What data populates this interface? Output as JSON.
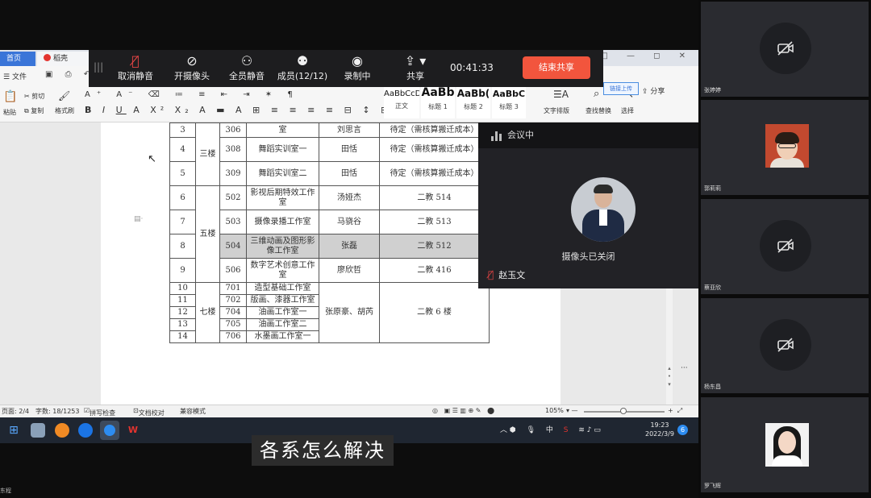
{
  "wps": {
    "tabs": {
      "home": "首页",
      "doc": "稻壳"
    },
    "window_controls": "□ — ◻ ✕",
    "share_note": "链接上传",
    "share": "分享",
    "file_menu": "文件",
    "ribbon": {
      "cut": "剪切",
      "copy": "复制",
      "paste": "粘贴",
      "format_painter": "格式刷",
      "styles": [
        {
          "sample": "AaBbCcDd",
          "label": "正文"
        },
        {
          "sample": "AaBb",
          "label": "标题 1"
        },
        {
          "sample": "AaBb(",
          "label": "标题 2"
        },
        {
          "sample": "AaBbC",
          "label": "标题 3"
        }
      ],
      "text_layout": "文字排版",
      "find_replace": "查找替换",
      "select": "选择"
    }
  },
  "table": {
    "rows": [
      {
        "no": "3",
        "room": "306",
        "name": "室",
        "person": "刘思言",
        "plan": "待定（需核算搬迁成本）"
      },
      {
        "no": "4",
        "room": "308",
        "name": "舞蹈实训室一",
        "person": "田恬",
        "plan": "待定（需核算搬迁成本）"
      },
      {
        "no": "5",
        "room": "309",
        "name": "舞蹈实训室二",
        "person": "田恬",
        "plan": "待定（需核算搬迁成本）"
      },
      {
        "no": "6",
        "room": "502",
        "name": "影视后期特效工作室",
        "person": "汤娅杰",
        "plan": "二教 514"
      },
      {
        "no": "7",
        "room": "503",
        "name": "摄像录播工作室",
        "person": "马骁谷",
        "plan": "二教 513"
      },
      {
        "no": "8",
        "room": "504",
        "name": "三维动画及图形影像工作室",
        "person": "张磊",
        "plan": "二教 512"
      },
      {
        "no": "9",
        "room": "506",
        "name": "数字艺术创意工作室",
        "person": "廖欣哲",
        "plan": "二教 416"
      },
      {
        "no": "10",
        "room": "701",
        "name": "造型基础工作室"
      },
      {
        "no": "11",
        "room": "702",
        "name": "版画、漆器工作室"
      },
      {
        "no": "12",
        "room": "704",
        "name": "油画工作室一"
      },
      {
        "no": "13",
        "room": "705",
        "name": "油画工作室二"
      },
      {
        "no": "14",
        "room": "706",
        "name": "水墨画工作室一"
      }
    ],
    "floor_3": "三楼",
    "floor_5": "五楼",
    "floor_7": "七楼",
    "floor7_person": "张原豪、胡芮",
    "floor7_plan": "二教 6 楼"
  },
  "statusbar": {
    "page": "页面: 2/4",
    "words": "字数: 18/1253",
    "spellcheck": "拼写检查",
    "proofread": "文档校对",
    "compat": "兼容模式",
    "zoom": "105%"
  },
  "taskbar": {
    "tray_input": "中",
    "time": "19:23",
    "date": "2022/3/9",
    "notifications": "6"
  },
  "meeting": {
    "controls": {
      "unmute": "取消静音",
      "camera_on": "开摄像头",
      "mute_all": "全员静音",
      "members": "成员(12/12)",
      "recording": "录制中",
      "share": "共享"
    },
    "elapsed": "00:41:33",
    "end_share": "结束共享",
    "speaker_window": {
      "status": "会议中",
      "camera_off": "摄像头已关闭",
      "name": "赵玉文"
    },
    "participants": [
      {
        "name": "张婷婷",
        "camera": "off"
      },
      {
        "name": "郭莉莉",
        "camera": "on"
      },
      {
        "name": "蔡亚欣",
        "camera": "off"
      },
      {
        "name": "杨东昌",
        "camera": "off"
      },
      {
        "name": "罗飞辉",
        "camera": "on"
      }
    ]
  },
  "subtitle": "各系怎么解决",
  "bottom_label": "东程",
  "colors": {
    "end_button": "#f2553d",
    "muted_icon": "#e64545",
    "wps_home_tab": "#3a75d8",
    "taskbar": "#1f2631"
  }
}
